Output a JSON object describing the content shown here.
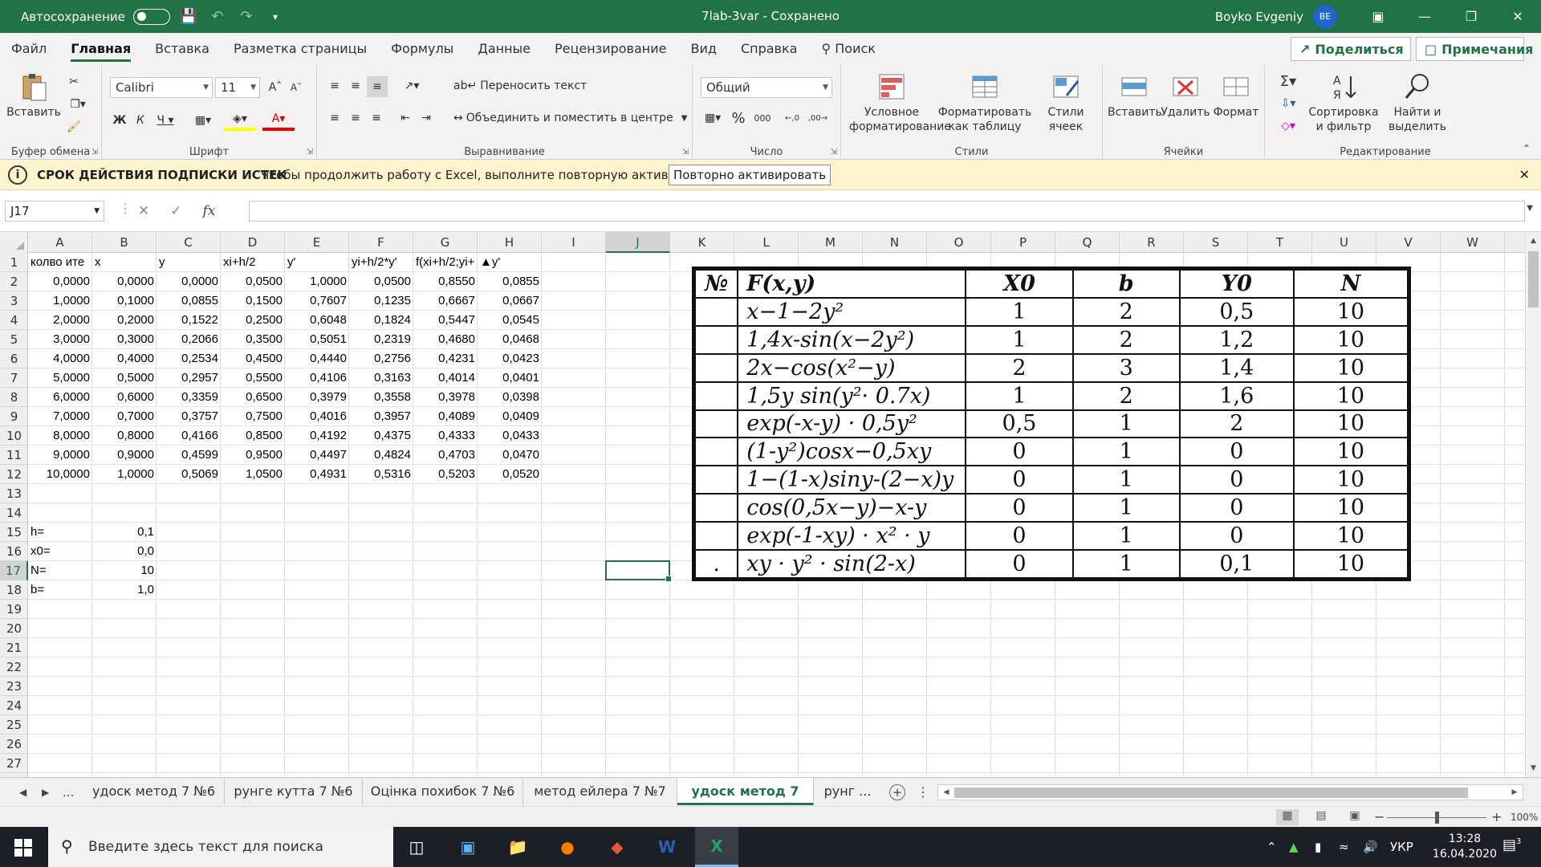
{
  "titlebar": {
    "autosave_label": "Автосохранение",
    "doc_title": "7lab-3var  -  Сохранено",
    "user_name": "Boyko Evgeniy",
    "user_initials": "BE"
  },
  "menu": {
    "tabs": [
      "Файл",
      "Главная",
      "Вставка",
      "Разметка страницы",
      "Формулы",
      "Данные",
      "Рецензирование",
      "Вид",
      "Справка",
      "Поиск"
    ],
    "active_tab": "Главная",
    "share_label": "Поделиться",
    "notes_label": "Примечания"
  },
  "ribbon": {
    "clipboard": {
      "label": "Буфер обмена",
      "paste_label": "Вставить"
    },
    "font": {
      "label": "Шрифт",
      "font_name": "Calibri",
      "font_size": "11"
    },
    "alignment": {
      "label": "Выравнивание",
      "wrap_label": "Переносить текст",
      "merge_label": "Объединить и поместить в центре"
    },
    "number": {
      "label": "Число",
      "format": "Общий"
    },
    "styles": {
      "label": "Стили",
      "cond_fmt": "Условное форматирование",
      "as_table": "Форматировать как таблицу",
      "cell_styles": "Стили ячеек"
    },
    "cells": {
      "label": "Ячейки",
      "insert": "Вставить",
      "delete": "Удалить",
      "format": "Формат"
    },
    "editing": {
      "label": "Редактирование",
      "sort": "Сортировка и фильтр",
      "find": "Найти и выделить"
    }
  },
  "notification": {
    "title": "СРОК ДЕЙСТВИЯ ПОДПИСКИ ИСТЕК",
    "text": "Чтобы продолжить работу с Excel, выполните повторную активацию.",
    "button": "Повторно активировать"
  },
  "formula_bar": {
    "name_box": "J17",
    "fx": "fx",
    "formula": ""
  },
  "grid": {
    "columns": [
      "A",
      "B",
      "C",
      "D",
      "E",
      "F",
      "G",
      "H",
      "I",
      "J",
      "K",
      "L",
      "M",
      "N",
      "O",
      "P",
      "Q",
      "R",
      "S",
      "T",
      "U",
      "V",
      "W"
    ],
    "selected_column": "J",
    "selected_row": "17",
    "rows": [
      "1",
      "2",
      "3",
      "4",
      "5",
      "6",
      "7",
      "8",
      "9",
      "10",
      "11",
      "12",
      "13",
      "14",
      "15",
      "16",
      "17",
      "18",
      "19",
      "20",
      "21",
      "22",
      "23",
      "24",
      "25",
      "26",
      "27",
      "28"
    ],
    "header_row": [
      "колво ите",
      "x",
      "y",
      "xi+h/2",
      "y'",
      "yi+h/2*y'",
      "f(xi+h/2;yi+",
      "▲y'"
    ],
    "data_rows": [
      [
        "0,0000",
        "0,0000",
        "0,0000",
        "0,0500",
        "1,0000",
        "0,0500",
        "0,8550",
        "0,0855"
      ],
      [
        "1,0000",
        "0,1000",
        "0,0855",
        "0,1500",
        "0,7607",
        "0,1235",
        "0,6667",
        "0,0667"
      ],
      [
        "2,0000",
        "0,2000",
        "0,1522",
        "0,2500",
        "0,6048",
        "0,1824",
        "0,5447",
        "0,0545"
      ],
      [
        "3,0000",
        "0,3000",
        "0,2066",
        "0,3500",
        "0,5051",
        "0,2319",
        "0,4680",
        "0,0468"
      ],
      [
        "4,0000",
        "0,4000",
        "0,2534",
        "0,4500",
        "0,4440",
        "0,2756",
        "0,4231",
        "0,0423"
      ],
      [
        "5,0000",
        "0,5000",
        "0,2957",
        "0,5500",
        "0,4106",
        "0,3163",
        "0,4014",
        "0,0401"
      ],
      [
        "6,0000",
        "0,6000",
        "0,3359",
        "0,6500",
        "0,3979",
        "0,3558",
        "0,3978",
        "0,0398"
      ],
      [
        "7,0000",
        "0,7000",
        "0,3757",
        "0,7500",
        "0,4016",
        "0,3957",
        "0,4089",
        "0,0409"
      ],
      [
        "8,0000",
        "0,8000",
        "0,4166",
        "0,8500",
        "0,4192",
        "0,4375",
        "0,4333",
        "0,0433"
      ],
      [
        "9,0000",
        "0,9000",
        "0,4599",
        "0,9500",
        "0,4497",
        "0,4824",
        "0,4703",
        "0,0470"
      ],
      [
        "10,0000",
        "1,0000",
        "0,5069",
        "1,0500",
        "0,4931",
        "0,5316",
        "0,5203",
        "0,0520"
      ]
    ],
    "params": [
      {
        "label": "h=",
        "value": "0,1"
      },
      {
        "label": "x0=",
        "value": "0,0"
      },
      {
        "label": "N=",
        "value": "10"
      },
      {
        "label": "b=",
        "value": "1,0"
      }
    ]
  },
  "picture_table": {
    "headers": [
      "№",
      "F(x,y)",
      "X0",
      "b",
      "Y0",
      "N"
    ],
    "rows": [
      [
        "",
        "x−1−2y²",
        "1",
        "2",
        "0,5",
        "10"
      ],
      [
        "",
        "1,4x-sin(x−2y²)",
        "1",
        "2",
        "1,2",
        "10"
      ],
      [
        "",
        "2x−cos(x²−y)",
        "2",
        "3",
        "1,4",
        "10"
      ],
      [
        "",
        "1,5y  sin(y²· 0.7x)",
        "1",
        "2",
        "1,6",
        "10"
      ],
      [
        "",
        "exp(-x-y) · 0,5y²",
        "0,5",
        "1",
        "2",
        "10"
      ],
      [
        "",
        "(1-y²)cosx−0,5xy",
        "0",
        "1",
        "0",
        "10"
      ],
      [
        "",
        "1−(1-x)siny-(2−x)y",
        "0",
        "1",
        "0",
        "10"
      ],
      [
        "",
        "cos(0,5x−y)−x-y",
        "0",
        "1",
        "0",
        "10"
      ],
      [
        "",
        "exp(-1-xy) · x² · y",
        "0",
        "1",
        "0",
        "10"
      ],
      [
        ".",
        "xy · y²  · sin(2-x)",
        "0",
        "1",
        "0,1",
        "10"
      ]
    ]
  },
  "sheets": {
    "tabs": [
      "удоск метод 7 №6",
      "рунге кутта 7 №6",
      "Оцінка похибок 7 №6",
      "метод ейлера 7 №7",
      "удоск метод 7 №7",
      "рунг ..."
    ],
    "active": "удоск метод 7 №7",
    "ellipsis": "..."
  },
  "status": {
    "zoom": "100%"
  },
  "taskbar": {
    "search_placeholder": "Введите здесь текст для поиска",
    "lang": "УКР",
    "time": "13:28",
    "date": "16.04.2020",
    "notif_count": "3"
  },
  "colors": {
    "excel_green": "#217346",
    "notify_bg": "#fff4ce"
  }
}
